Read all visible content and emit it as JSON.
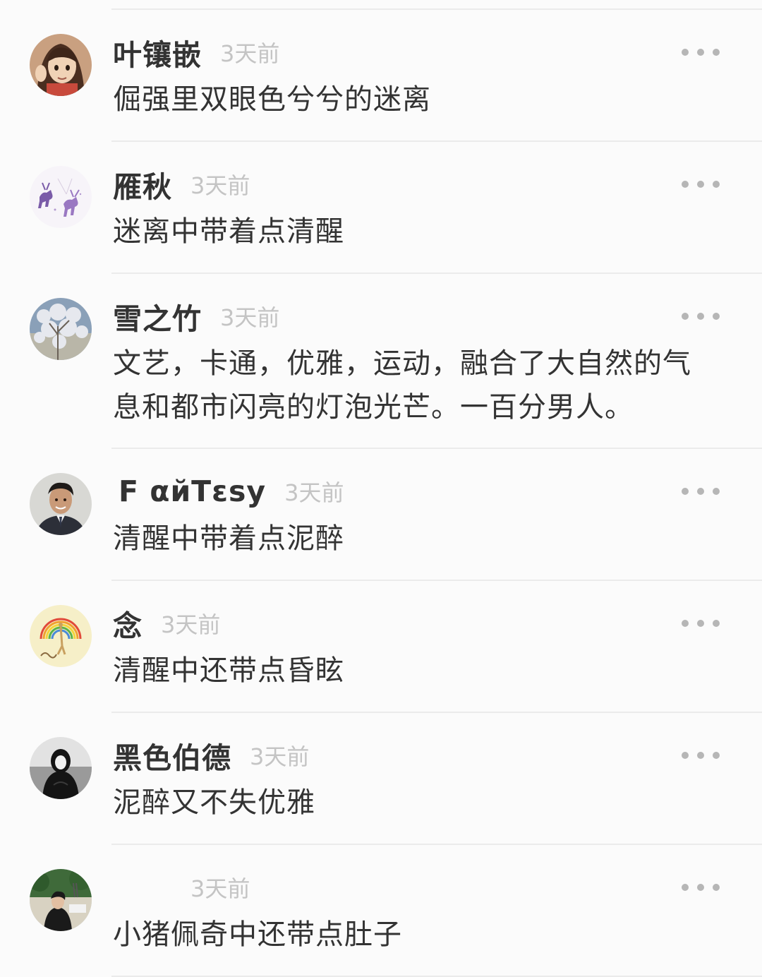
{
  "comments": [
    {
      "username": "叶镶嵌",
      "time": "3天前",
      "content": "倔强里双眼色兮兮的迷离",
      "avatar_icon": "anime-girl-avatar-icon"
    },
    {
      "username": "雁秋",
      "time": "3天前",
      "content": "迷离中带着点清醒",
      "avatar_icon": "deer-avatar-icon"
    },
    {
      "username": "雪之竹",
      "time": "3天前",
      "content": "文艺，卡通，优雅，运动，融合了大自然的气息和都市闪亮的灯泡光芒。一百分男人。",
      "avatar_icon": "snowy-tree-avatar-icon"
    },
    {
      "username": "F αйTεsy",
      "time": "3天前",
      "content": "清醒中带着点泥醉",
      "avatar_icon": "man-in-suit-avatar-icon"
    },
    {
      "username": "念",
      "time": "3天前",
      "content": "清醒中还带点昏眩",
      "avatar_icon": "rainbow-giraffe-avatar-icon"
    },
    {
      "username": "黑色伯德",
      "time": "3天前",
      "content": "泥醉又不失优雅",
      "avatar_icon": "hooded-figure-avatar-icon"
    },
    {
      "username": "",
      "time": "3天前",
      "content": "小猪佩奇中还带点肚子",
      "avatar_icon": "outdoor-photo-avatar-icon"
    }
  ],
  "colors": {
    "background": "#fbfbfb",
    "username": "#333333",
    "content": "#333333",
    "time": "#c4c4c4",
    "divider": "#ebebeb",
    "more_dots": "#b6b6b6"
  }
}
